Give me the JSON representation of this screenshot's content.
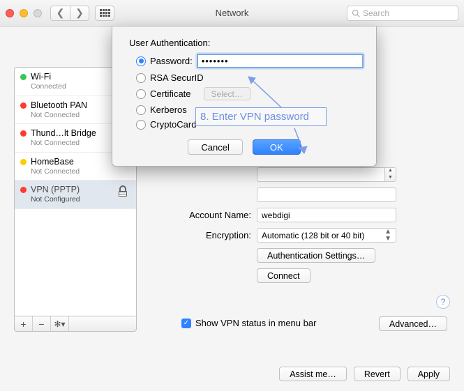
{
  "window": {
    "title": "Network",
    "search_placeholder": "Search"
  },
  "sidebar": {
    "items": [
      {
        "name": "Wi-Fi",
        "status": "Connected",
        "color": "green"
      },
      {
        "name": "Bluetooth PAN",
        "status": "Not Connected",
        "color": "red"
      },
      {
        "name": "Thund…lt Bridge",
        "status": "Not Connected",
        "color": "red"
      },
      {
        "name": "HomeBase",
        "status": "Not Connected",
        "color": "yellow"
      },
      {
        "name": "VPN (PPTP)",
        "status": "Not Configured",
        "color": "red"
      }
    ]
  },
  "form": {
    "account_name_label": "Account Name:",
    "account_name_value": "webdigi",
    "encryption_label": "Encryption:",
    "encryption_value": "Automatic (128 bit or 40 bit)",
    "auth_settings_btn": "Authentication Settings…",
    "connect_btn": "Connect",
    "show_status_label": "Show VPN status in menu bar",
    "advanced_btn": "Advanced…",
    "help": "?"
  },
  "bottom": {
    "assist": "Assist me…",
    "revert": "Revert",
    "apply": "Apply"
  },
  "sheet": {
    "heading": "User Authentication:",
    "password_label": "Password:",
    "password_value": "•••••••",
    "rsa_label": "RSA SecurID",
    "cert_label": "Certificate",
    "cert_select": "Select…",
    "kerberos_label": "Kerberos",
    "crypto_label": "CryptoCard",
    "cancel": "Cancel",
    "ok": "OK"
  },
  "annotation": {
    "text": "8. Enter VPN password"
  }
}
